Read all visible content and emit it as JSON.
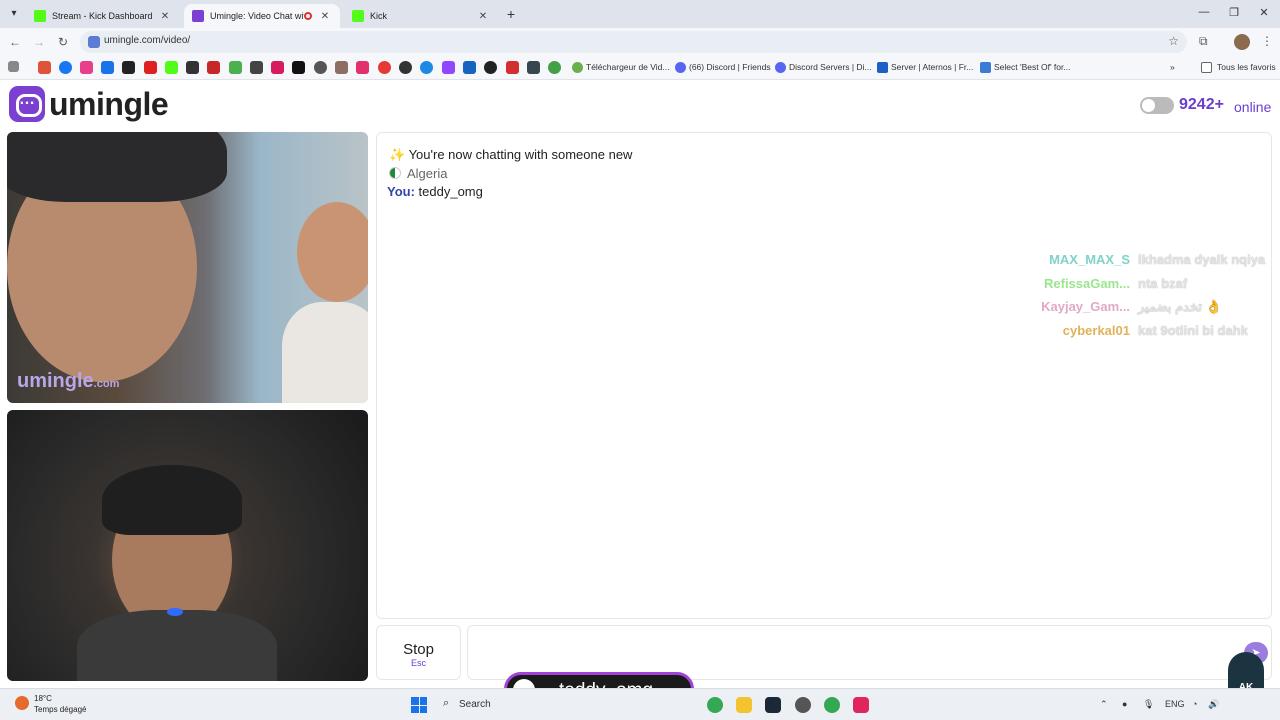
{
  "browser": {
    "tabs": [
      {
        "label": "Stream - Kick Dashboard",
        "favicon_color": "#53fc18",
        "active": false
      },
      {
        "label": "Umingle: Video Chat with St",
        "favicon_color": "#7b3fd1",
        "active": true
      },
      {
        "label": "Kick",
        "favicon_color": "#53fc18",
        "active": false
      }
    ],
    "address": "umingle.com/video/",
    "bookmarks": [
      {
        "label": "Téléchargeur de Vid...",
        "color": "#6ab04c"
      },
      {
        "label": "(66) Discord | Friends",
        "color": "#5865f2"
      },
      {
        "label": "Discord Servers | Di...",
        "color": "#5865f2"
      },
      {
        "label": "Server | Aternos | Fr...",
        "color": "#1e5ec7"
      },
      {
        "label": "Select 'Best Of' for...",
        "color": "#3a7bd5"
      }
    ],
    "all_bookmarks": "Tous les favoris"
  },
  "site": {
    "logo_text": "umingle",
    "online_count": "9242+",
    "online_label": "online",
    "accent_color": "#6a3fd0"
  },
  "videos": {
    "watermark": "umingle",
    "watermark_suffix": ".com"
  },
  "chat": {
    "system_icon": "✨",
    "system_message": "You're now chatting with someone new",
    "country": "Algeria",
    "you_label": "You:",
    "you_message": "teddy_omg"
  },
  "stream_chat": [
    {
      "user": "MAX_MAX_S",
      "message": "lkhadma dyalk nqiya",
      "color": "#7fd3c9"
    },
    {
      "user": "RefissaGam...",
      "message": "nta bzaf",
      "color": "#9be58f"
    },
    {
      "user": "Kayjay_Gam...",
      "message": "تخدم بضمير 👌",
      "color": "#e0a9c6"
    },
    {
      "user": "cyberkal01",
      "message": "kat 9otlini bi dahk",
      "color": "#e0b25a"
    }
  ],
  "controls": {
    "stop_label": "Stop",
    "stop_key": "Esc",
    "input_value": "",
    "send_icon": "send-arrow-icon"
  },
  "overlay_badge": {
    "name": "teddy_omg"
  },
  "streamer_logo": "AK",
  "taskbar": {
    "temperature": "18°C",
    "weather": "Temps dégagé",
    "search": "Search",
    "language": "ENG"
  }
}
